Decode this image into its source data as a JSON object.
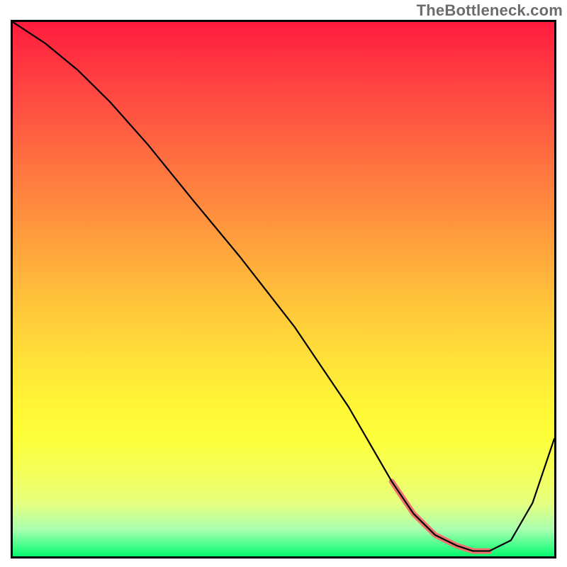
{
  "watermark": "TheBottleneck.com",
  "chart_data": {
    "type": "line",
    "title": "",
    "xlabel": "",
    "ylabel": "",
    "xlim": [
      0,
      100
    ],
    "ylim": [
      0,
      100
    ],
    "grid": false,
    "legend": false,
    "series": [
      {
        "name": "curve",
        "color": "#000000",
        "width": 2.2,
        "x": [
          0,
          6,
          12,
          18,
          25,
          33,
          42,
          52,
          62,
          66,
          70,
          74,
          78,
          82,
          85,
          88,
          92,
          96,
          100
        ],
        "values": [
          100,
          96,
          91,
          85,
          77,
          67,
          56,
          43,
          28,
          21,
          14,
          8,
          4,
          2,
          1,
          1,
          3,
          10,
          22
        ]
      },
      {
        "name": "highlight",
        "color": "#f0746e",
        "width": 8,
        "x": [
          70,
          74,
          78,
          82,
          85,
          88
        ],
        "values": [
          14,
          8,
          4,
          2,
          1,
          1
        ]
      }
    ],
    "gradient_stops": [
      {
        "pos": 0,
        "color": "#ff1b3d"
      },
      {
        "pos": 50,
        "color": "#ffc83a"
      },
      {
        "pos": 80,
        "color": "#f4ff58"
      },
      {
        "pos": 100,
        "color": "#06f76c"
      }
    ]
  }
}
